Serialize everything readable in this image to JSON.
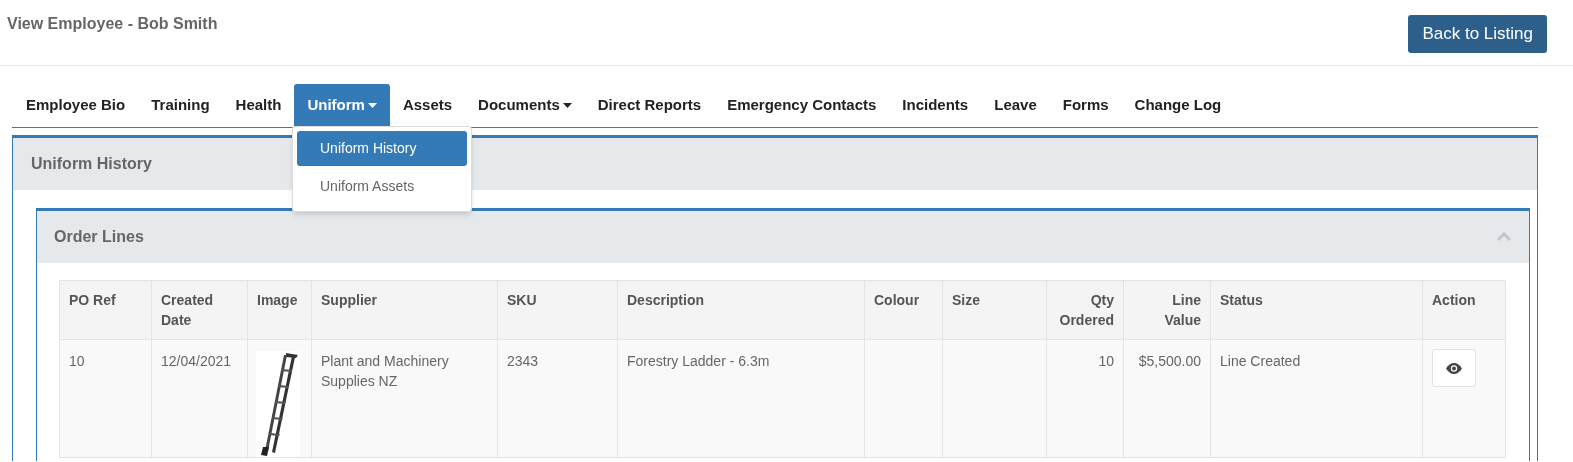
{
  "page_title": "View Employee - Bob Smith",
  "back_button": "Back to Listing",
  "tabs": [
    {
      "label": "Employee Bio",
      "selected": false,
      "dropdown": false
    },
    {
      "label": "Training",
      "selected": false,
      "dropdown": false
    },
    {
      "label": "Health",
      "selected": false,
      "dropdown": false
    },
    {
      "label": "Uniform",
      "selected": true,
      "dropdown": true
    },
    {
      "label": "Assets",
      "selected": false,
      "dropdown": false
    },
    {
      "label": "Documents",
      "selected": false,
      "dropdown": true
    },
    {
      "label": "Direct Reports",
      "selected": false,
      "dropdown": false
    },
    {
      "label": "Emergency Contacts",
      "selected": false,
      "dropdown": false
    },
    {
      "label": "Incidents",
      "selected": false,
      "dropdown": false
    },
    {
      "label": "Leave",
      "selected": false,
      "dropdown": false
    },
    {
      "label": "Forms",
      "selected": false,
      "dropdown": false
    },
    {
      "label": "Change Log",
      "selected": false,
      "dropdown": false
    }
  ],
  "dropdown_menu": [
    {
      "label": "Uniform History",
      "selected": true
    },
    {
      "label": "Uniform Assets",
      "selected": false
    }
  ],
  "panel_title": "Uniform History",
  "inner_panel": {
    "title": "Order Lines",
    "expanded": true
  },
  "table": {
    "columns": [
      {
        "label": "PO Ref",
        "kind": "text"
      },
      {
        "label": "Created Date",
        "kind": "text"
      },
      {
        "label": "Image",
        "kind": "text"
      },
      {
        "label": "Supplier",
        "kind": "text"
      },
      {
        "label": "SKU",
        "kind": "text"
      },
      {
        "label": "Description",
        "kind": "text"
      },
      {
        "label": "Colour",
        "kind": "text"
      },
      {
        "label": "Size",
        "kind": "text"
      },
      {
        "label": "Qty Ordered",
        "kind": "number"
      },
      {
        "label": "Line Value",
        "kind": "number"
      },
      {
        "label": "Status",
        "kind": "text"
      },
      {
        "label": "Action",
        "kind": "text"
      }
    ],
    "rows": [
      {
        "cells": [
          {
            "kind": "text",
            "text": "10"
          },
          {
            "kind": "text",
            "text": "12/04/2021"
          },
          {
            "kind": "picture"
          },
          {
            "kind": "text",
            "text": "Plant and Machinery Supplies NZ"
          },
          {
            "kind": "text",
            "text": "2343"
          },
          {
            "kind": "text",
            "text": "Forestry Ladder - 6.3m"
          },
          {
            "kind": "empty"
          },
          {
            "kind": "empty"
          },
          {
            "kind": "text",
            "text": "10"
          },
          {
            "kind": "text",
            "text": "$5,500.00"
          },
          {
            "kind": "text",
            "text": "Line Created"
          },
          {
            "kind": "view-button"
          }
        ]
      }
    ]
  }
}
